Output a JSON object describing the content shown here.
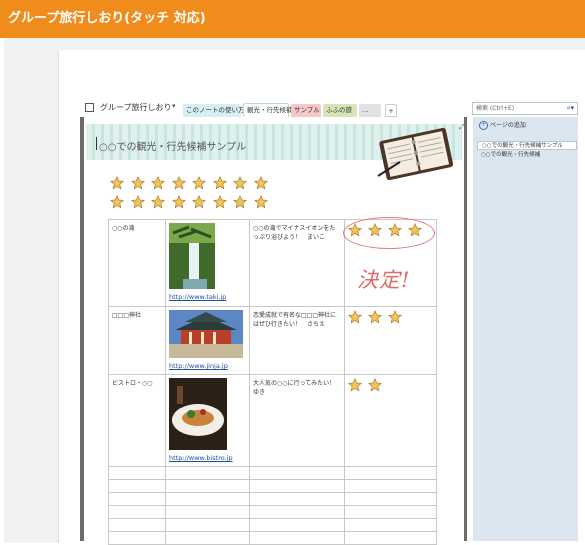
{
  "banner": {
    "title": "グループ旅行しおり(タッチ 対応)"
  },
  "notebook": {
    "name": "グループ旅行しおり",
    "caret": "▾"
  },
  "tabs": [
    {
      "label": "このノートの使い方"
    },
    {
      "label": "観光・行先候補"
    },
    {
      "label": "サンプル"
    },
    {
      "label": "ふふの旅"
    },
    {
      "label": "…"
    },
    {
      "label": "+"
    }
  ],
  "search": {
    "placeholder": "検索 (Ctrl+E)"
  },
  "pages_pane": {
    "add_page": "ページの追加",
    "pages": [
      "○○での観光・行先候補サンプル",
      "○○での観光・行先候補"
    ]
  },
  "page": {
    "title": "○○での観光・行先候補サンプル"
  },
  "annotation": {
    "handwriting": "決定!"
  },
  "table": {
    "rows": [
      {
        "place": "○○の滝",
        "link": "http://www.taki.jp",
        "comment": "○○の滝でマイナスイオンをたっぷり浴びよう！　まいこ",
        "stars": 4,
        "photo": "waterfall"
      },
      {
        "place": "□□□神社",
        "link": "http://www.jinja.jp",
        "comment": "恋愛成就で有名な□□□神社にはぜひ行きたい！　さちえ",
        "stars": 3,
        "photo": "shrine"
      },
      {
        "place": "ビストロ・○○",
        "link": "http://www.bistro.jp",
        "comment": "大人気の○○に行ってみたい！\nゆき",
        "stars": 2,
        "photo": "dish"
      }
    ],
    "empty_rows": 6
  },
  "colors": {
    "banner": "#f08c1c",
    "pane": "#dce6f1",
    "link": "#1f4e9e",
    "ink": "#e06b6b"
  }
}
